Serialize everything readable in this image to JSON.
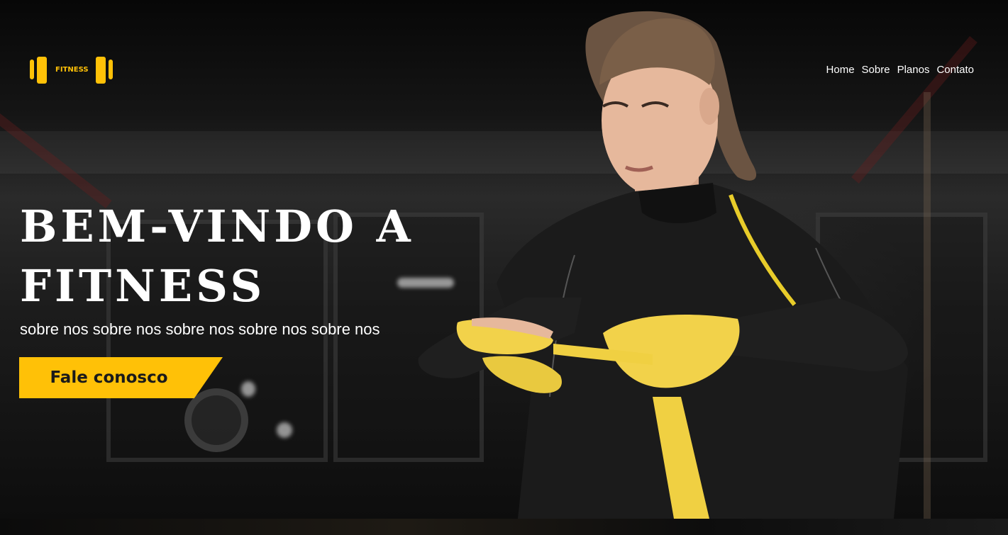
{
  "header": {
    "logo_text": "FITNESS",
    "nav": [
      {
        "label": "Home"
      },
      {
        "label": "Sobre"
      },
      {
        "label": "Planos"
      },
      {
        "label": "Contato"
      }
    ]
  },
  "hero": {
    "headline": "BEM-VINDO A FITNESS",
    "subtitle": "sobre nos sobre nos sobre nos sobre nos sobre nos",
    "cta_label": "Fale conosco",
    "image_alt": "athlete wrapping hands with yellow wraps"
  },
  "colors": {
    "accent": "#ffc107",
    "text": "#ffffff",
    "background": "#000000"
  },
  "icons": {
    "logo": "dumbbell-icon"
  }
}
